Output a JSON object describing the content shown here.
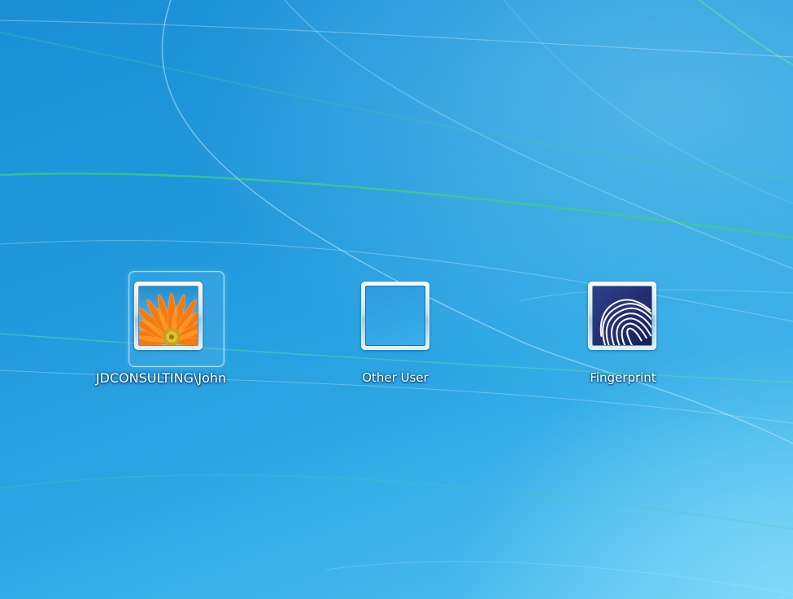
{
  "screen": "Windows logon - user selection",
  "users": [
    {
      "label": "JDCONSULTING\\John",
      "picture": "orange-gerbera-flower",
      "selected": true
    },
    {
      "label": "Other User",
      "picture": "blank-tile",
      "selected": false
    },
    {
      "label": "Fingerprint",
      "picture": "fingerprint-icon",
      "selected": false
    }
  ],
  "colors": {
    "background_top": "#1b8fd6",
    "background_bottom": "#63c8f2",
    "label_text": "#ffffff"
  }
}
